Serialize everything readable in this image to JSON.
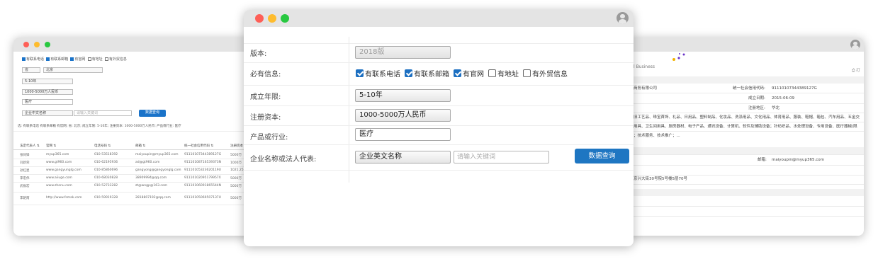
{
  "left_window": {
    "checkboxes": [
      {
        "label": "有联系电话",
        "checked": true
      },
      {
        "label": "有联系邮箱",
        "checked": true
      },
      {
        "label": "有官网",
        "checked": true
      },
      {
        "label": "有地址",
        "checked": false
      },
      {
        "label": "有外贸信息",
        "checked": false
      }
    ],
    "province": "省",
    "city": "北京",
    "years": "5-10年",
    "capital": "1000-5000万人民币",
    "industry": "医疗",
    "name_select": "企业中文名称",
    "keyword_placeholder": "请输入关键词",
    "query_button": "数据查询",
    "summary": "选: 有联系电话 有联系邮箱 有官网;  省: 北京;  成立年限: 5-10年;  注册资本: 1000-5000万人民币;  产品或行业: 医疗",
    "table_headers": [
      "法定代表人 ⇅",
      "官网 ⇅",
      "电话号码 ⇅",
      "邮箱 ⇅",
      "统一社会信用代码 ⇅",
      "注册资本 ⇅"
    ],
    "rows": [
      [
        "张同锋",
        "myup365.com",
        "010-53518392",
        "maiyoupin@myup365.com",
        "91110107344389127G",
        "5000万"
      ],
      [
        "刘新荣",
        "www.gt960.com",
        "010-62195936",
        "ad@gt960.com",
        "91110108716539373N",
        "1000万"
      ],
      [
        "孙红星",
        "www.gangyunglg.com",
        "010-85860696",
        "gangyong@gangyonglg.com",
        "91110105323620119U",
        "1021.25"
      ],
      [
        "李宏伟",
        "www.aiiuge.com",
        "010-68030828",
        "38909994@qq.com",
        "91110102095179957X",
        "5000万"
      ],
      [
        "武振宏",
        "www.zhenu.com",
        "010-52733282",
        "zt@wngp@163.com",
        "91110106091865544N",
        "5000万"
      ],
      [
        "李艳南",
        "http://www.fsmak.com",
        "010-59919328",
        "2818807192@qq.com",
        "91110105069507137U",
        "5000万"
      ]
    ]
  },
  "main_window": {
    "version_label": "版本:",
    "version_value": "2018版",
    "required_label": "必有信息:",
    "required_options": [
      {
        "label": "有联系电话",
        "checked": true
      },
      {
        "label": "有联系邮箱",
        "checked": true
      },
      {
        "label": "有官网",
        "checked": true
      },
      {
        "label": "有地址",
        "checked": false
      },
      {
        "label": "有外贸信息",
        "checked": false
      }
    ],
    "years_label": "成立年限:",
    "years_value": "5-10年",
    "capital_label": "注册资本:",
    "capital_value": "1000-5000万人民币",
    "industry_label": "产品或行业:",
    "industry_value": "医疗",
    "name_label": "企业名称或法人代表:",
    "name_select_value": "企业英文名称",
    "keyword_placeholder": "请输入关键词",
    "query_button": "数据查询"
  },
  "right_window": {
    "brand_suffix": "l Business",
    "print_icon_label": "打",
    "company_short": "商务有限公司",
    "credit_code_label": "统一社会信用代码:",
    "credit_code_value": "91110107344389127G",
    "founded_label": "成立日期:",
    "founded_value": "2015-06-09",
    "region_label": "注册地区:",
    "region_value": "华北",
    "scope_line_1": "旧工艺品、珠宝首饰、礼品、日用品、塑料制品、化妆品、洗涤用品、文化用品、体育用品、服装、鞋帽、箱包、汽车用品、五金交",
    "scope_line_2": "用具、卫生间用具、厨房器材、电子产品、通讯设备、计算机、软件及辅助设备；针纺织品、水处理设备、专用设备、医疗器械(限",
    "scope_line_3": "；技术服务、技术推广；...",
    "email_label": "邮箱:",
    "email_value": "maiyoupin@myup365.com",
    "address": "京兴大街30号院5号楼5层70号"
  },
  "colors": {
    "accent": "#1e76c2",
    "dot_red": "#fe5f57",
    "dot_yellow": "#febc2e",
    "dot_green": "#28c840",
    "titlebar": "#e4e4e4"
  }
}
